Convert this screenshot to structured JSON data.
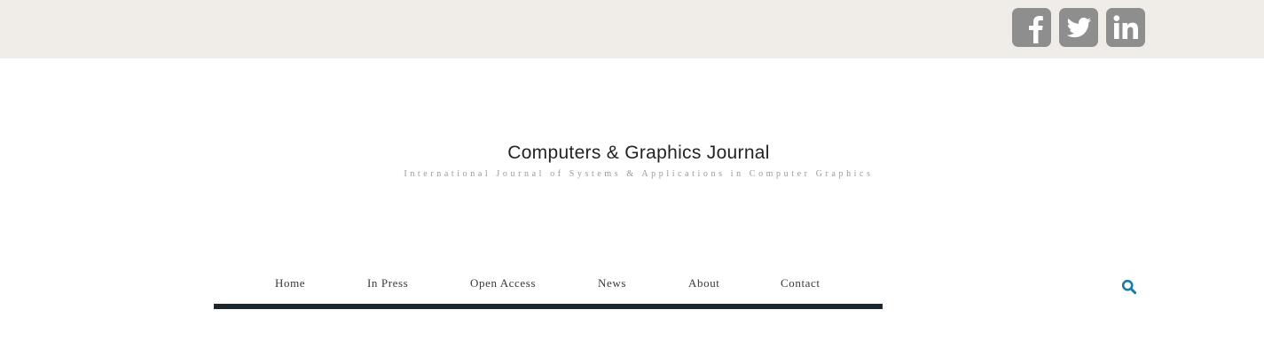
{
  "header": {
    "social": [
      {
        "name": "Facebook",
        "icon": "facebook-icon"
      },
      {
        "name": "Twitter",
        "icon": "twitter-icon"
      },
      {
        "name": "LinkedIn",
        "icon": "linkedin-icon"
      }
    ],
    "background": "#f0ede8",
    "icon_color": "#8e8e8e"
  },
  "site": {
    "title": "Computers & Graphics Journal",
    "tagline": "International Journal of Systems & Applications in Computer Graphics"
  },
  "nav": {
    "items": [
      {
        "label": "Home"
      },
      {
        "label": "In Press"
      },
      {
        "label": "Open Access"
      },
      {
        "label": "News"
      },
      {
        "label": "About"
      },
      {
        "label": "Contact"
      }
    ],
    "underline_color": "#1c262c"
  },
  "search": {
    "icon": "search-icon",
    "color": "#1a7aa8"
  }
}
